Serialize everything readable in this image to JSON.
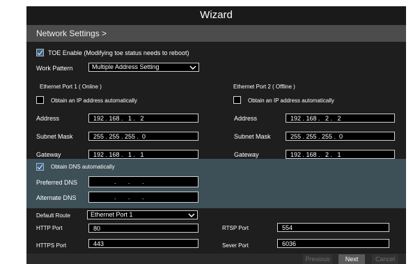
{
  "window": {
    "title": "Wizard"
  },
  "breadcrumb": {
    "label": "Network Settings  >"
  },
  "toe": {
    "label": "TOE Enable  (Modifying toe status needs to reboot)",
    "checked": true
  },
  "work_pattern": {
    "label": "Work Pattern",
    "value": "Multiple Address Setting"
  },
  "port1": {
    "title": "Ethernet Port 1 ( Online )",
    "obtain_label": "Obtain an IP address automatically",
    "address_label": "Address",
    "address": "192 . 168 .   1 .   2",
    "subnet_label": "Subnet Mask",
    "subnet": "255 . 255 . 255 .  0",
    "gateway_label": "Gateway",
    "gateway": "192 . 168 .   1 .   1"
  },
  "port2": {
    "title": "Ethernet Port 2 ( Offline )",
    "obtain_label": "Obtain an IP address automatically",
    "address_label": "Address",
    "address": "192 . 168 .   2 .   2",
    "subnet_label": "Subnet Mask",
    "subnet": "255 . 255 . 255 .  0",
    "gateway_label": "Gateway",
    "gateway": "192 . 168 .   2 .   1"
  },
  "dns": {
    "obtain_label": "Obtain DNS automatically",
    "preferred_label": "Preferred DNS",
    "preferred": "            .       .       .",
    "alternate_label": "Alternate DNS",
    "alternate": "            .       .       ."
  },
  "default_route": {
    "label": "Default Route",
    "value": "Ethernet Port 1"
  },
  "ports": {
    "http_label": "HTTP Port",
    "http": "80",
    "https_label": "HTTPS Port",
    "https": "443",
    "rtsp_label": "RTSP Port",
    "rtsp": "554",
    "server_label": "Sever Port",
    "server": "6036"
  },
  "footer": {
    "previous": "Previous",
    "next": "Next",
    "cancel": "Cancel"
  },
  "colors": {
    "accent": "#3b5f7d",
    "dns_band": "#3d4f57",
    "background": "#1e1e1e"
  }
}
